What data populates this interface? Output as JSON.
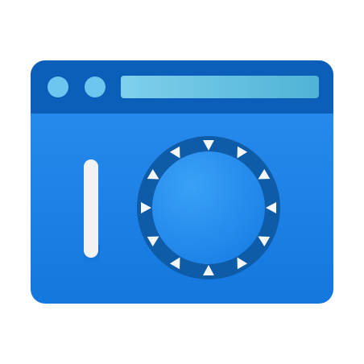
{
  "icon": {
    "semantic_name": "browser-window-settings-icon",
    "parts": [
      "window-frame",
      "title-bar",
      "window-control-dots",
      "address-bar",
      "slider-handle",
      "gear-dial"
    ]
  },
  "colors": {
    "window_body_top": "#2b8ff0",
    "window_body_bottom": "#1377de",
    "title_bar": "#0b5fb8",
    "title_bar_top": "#1565c0",
    "dot": "#6cc6f0",
    "address_bar_left": "#7fd0ec",
    "address_bar_right": "#4fb3d6",
    "slider": "#f2f2f2",
    "gear_ring": "#0e5ca8",
    "gear_teeth": "#f4f7fb",
    "gear_center_top": "#3aa1f7",
    "gear_center_bottom": "#1a7fe6"
  }
}
